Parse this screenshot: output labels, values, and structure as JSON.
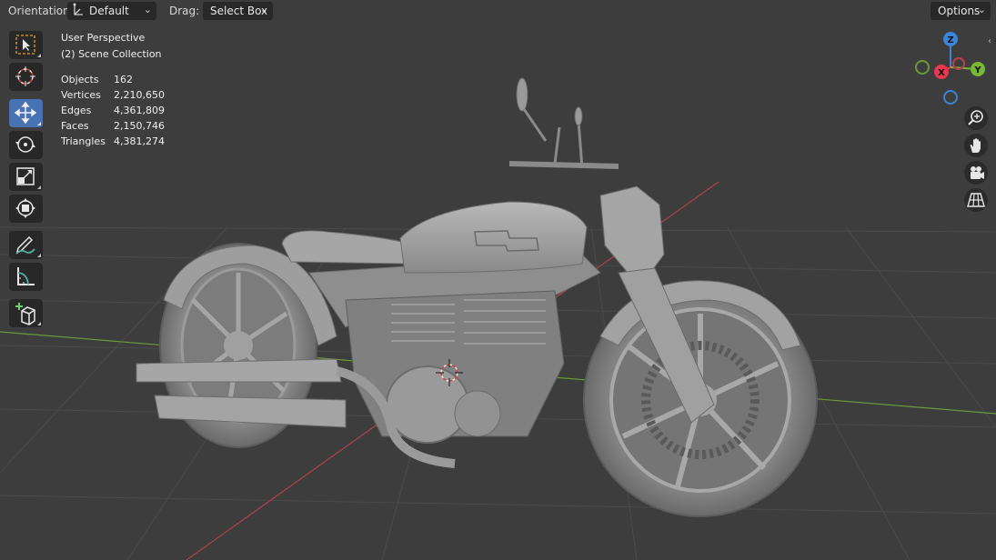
{
  "header": {
    "orientation_label": "Orientation:",
    "orientation_value": "Default",
    "drag_label": "Drag:",
    "drag_value": "Select Box",
    "options_label": "Options"
  },
  "overlay": {
    "view_name": "User Perspective",
    "collection": "(2) Scene Collection",
    "stats": [
      {
        "label": "Objects",
        "value": "162"
      },
      {
        "label": "Vertices",
        "value": "2,210,650"
      },
      {
        "label": "Edges",
        "value": "4,361,809"
      },
      {
        "label": "Faces",
        "value": "2,150,746"
      },
      {
        "label": "Triangles",
        "value": "4,381,274"
      }
    ]
  },
  "gizmo": {
    "z": "Z",
    "x": "X",
    "y": "Y"
  },
  "toolbar": {
    "tools": [
      "select-box",
      "cursor",
      "move",
      "rotate",
      "scale",
      "transform",
      "annotate",
      "measure",
      "add-cube"
    ],
    "active": "move"
  },
  "navigation": [
    "zoom",
    "pan",
    "camera",
    "perspective-toggle"
  ],
  "colors": {
    "viewport_bg": "#3d3d3d",
    "active_tool": "#4772b3",
    "axis_x": "#e8394e",
    "axis_y": "#78b832",
    "axis_z": "#3b84d6"
  }
}
